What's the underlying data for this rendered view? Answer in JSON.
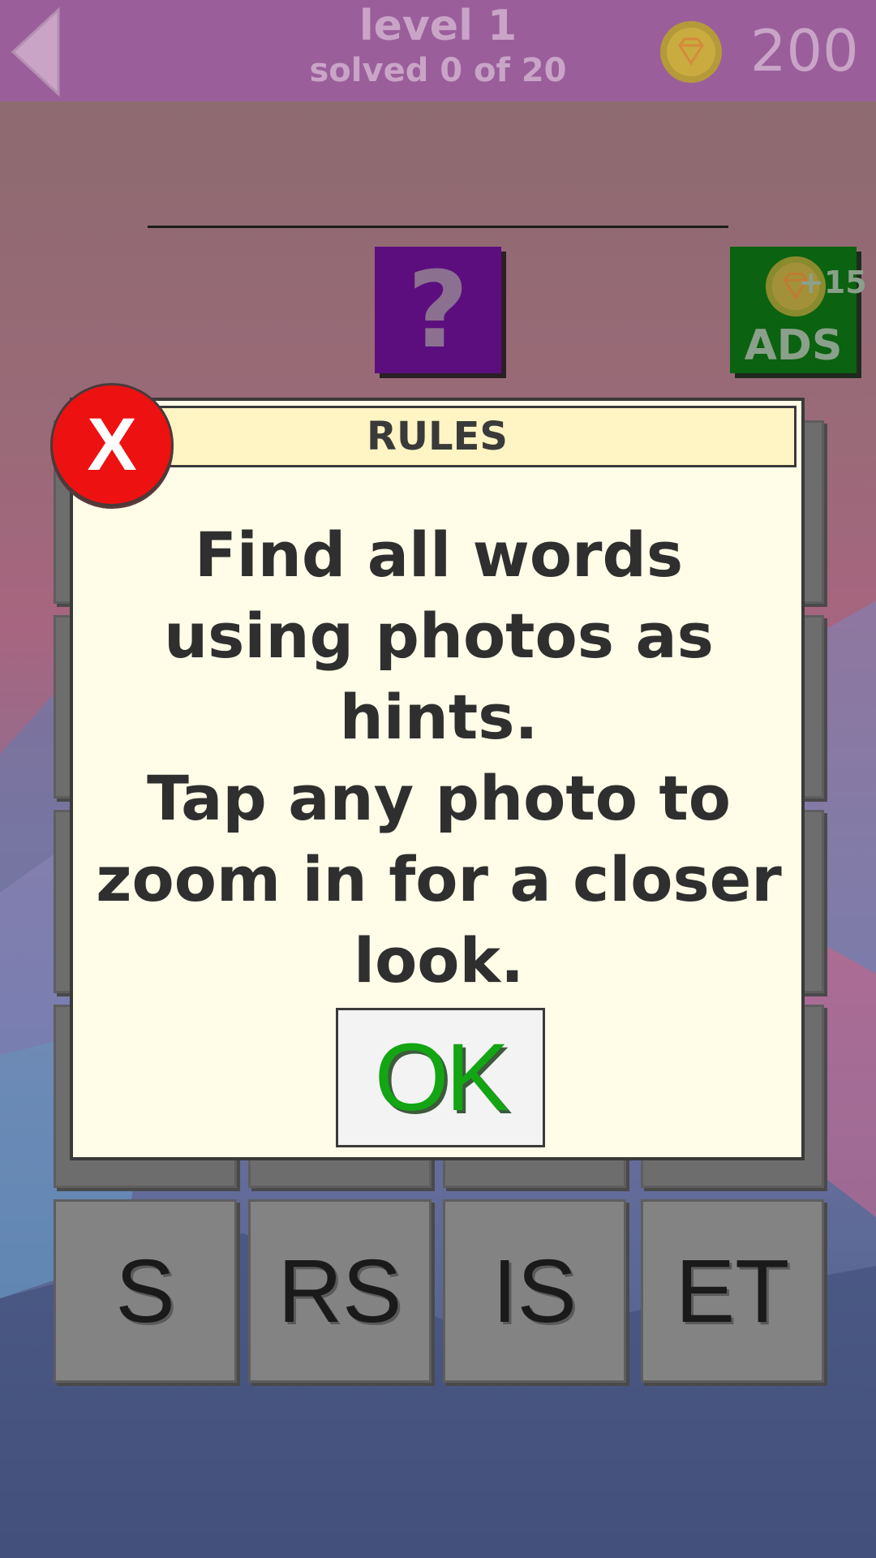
{
  "header": {
    "level": "level 1",
    "solved": "solved 0 of 20",
    "coins": "200"
  },
  "hint_button": {
    "label": "?"
  },
  "ads_button": {
    "bonus": "+15",
    "label": "ADS"
  },
  "letter_tiles": [
    "S",
    "RS",
    "IS",
    "ET"
  ],
  "modal": {
    "title": "RULES",
    "rule_1": "Find all words using photos as hints.",
    "rule_2": "Tap any photo to zoom in for a closer look.",
    "ok_label": "OK",
    "close_label": "X"
  },
  "colors": {
    "topbar": "#9a5f9b",
    "hint": "#5d0e7e",
    "ads": "#0b6210",
    "close": "#ee1111",
    "ok_text": "#13a513"
  },
  "icons": {
    "back": "back-arrow-icon",
    "coin": "diamond-coin-icon"
  }
}
